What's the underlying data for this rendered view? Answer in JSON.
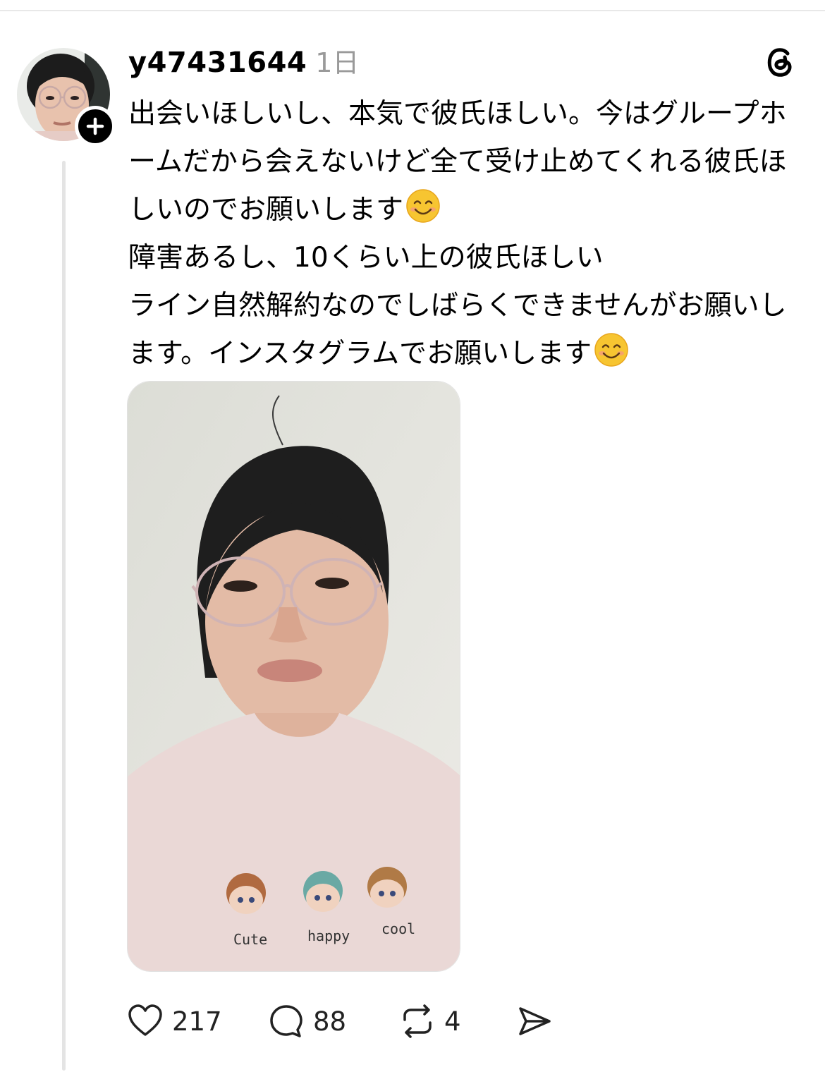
{
  "post": {
    "username": "y47431644",
    "timestamp": "1日",
    "paragraphs": [
      {
        "text": "出会いほしいし、本気で彼氏ほしい。今はグループホームだから会えないけど全て受け止めてくれる彼氏ほしいのでお願いします",
        "emoji": "smiling-face"
      },
      {
        "text": "障害あるし、10くらい上の彼氏ほしい",
        "emoji": null
      },
      {
        "text": "ライン自然解約なのでしばらくできませんがお願いします。インスタグラムでお願いします",
        "emoji": "smiling-face"
      }
    ],
    "media": {
      "shirt_print_labels": [
        "Cute",
        "happy",
        "cool"
      ]
    }
  },
  "actions": {
    "likes": "217",
    "replies": "88",
    "reposts": "4"
  },
  "icons": {
    "brand": "threads-logo-icon",
    "follow": "plus-icon",
    "like": "heart-icon",
    "reply": "comment-bubble-icon",
    "repost": "repost-arrows-icon",
    "share": "send-icon"
  },
  "colors": {
    "text": "#000000",
    "muted": "#9a9a9a",
    "thread_line": "#e4e4e4",
    "shirt": "#ead8d6"
  }
}
